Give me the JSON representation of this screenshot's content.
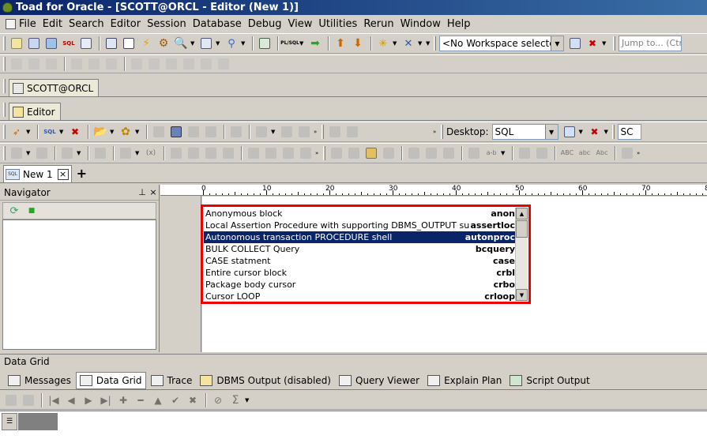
{
  "window": {
    "title": "Toad for Oracle - [SCOTT@ORCL - Editor (New 1)]"
  },
  "menu": [
    "File",
    "Edit",
    "Search",
    "Editor",
    "Session",
    "Database",
    "Debug",
    "View",
    "Utilities",
    "Rerun",
    "Window",
    "Help"
  ],
  "toolbar": {
    "workspace": "<No Workspace selected>",
    "jump_placeholder": "Jump to... (Ctrl",
    "desktop_label": "Desktop:",
    "desktop_value": "SQL",
    "sc_value": "SC"
  },
  "connection_tab": "SCOTT@ORCL",
  "window_tab": "Editor",
  "doc_tab": {
    "label": "New 1",
    "close": "×",
    "add": "+",
    "icon": "SQL"
  },
  "navigator": {
    "title": "Navigator",
    "pin": "⊥",
    "close": "×"
  },
  "ruler": [
    "0",
    "10",
    "20",
    "30",
    "40",
    "50",
    "60",
    "70",
    "8"
  ],
  "completion": {
    "items": [
      {
        "desc": "Anonymous block",
        "key": "anon",
        "selected": false
      },
      {
        "desc": "Local Assertion Procedure with supporting DBMS_OUTPUT substitute",
        "key": "assertloc",
        "selected": false
      },
      {
        "desc": "Autonomous transaction PROCEDURE shell",
        "key": "autonproc",
        "selected": true
      },
      {
        "desc": "BULK COLLECT Query",
        "key": "bcquery",
        "selected": false
      },
      {
        "desc": "CASE statment",
        "key": "case",
        "selected": false
      },
      {
        "desc": "Entire cursor block",
        "key": "crbl",
        "selected": false
      },
      {
        "desc": "Package body cursor",
        "key": "crbo",
        "selected": false
      },
      {
        "desc": "Cursor LOOP",
        "key": "crloop",
        "selected": false
      }
    ]
  },
  "data_grid": {
    "title": "Data Grid",
    "tabs": [
      "Messages",
      "Data Grid",
      "Trace",
      "DBMS Output (disabled)",
      "Query Viewer",
      "Explain Plan",
      "Script Output"
    ],
    "active_tab": "Data Grid"
  }
}
